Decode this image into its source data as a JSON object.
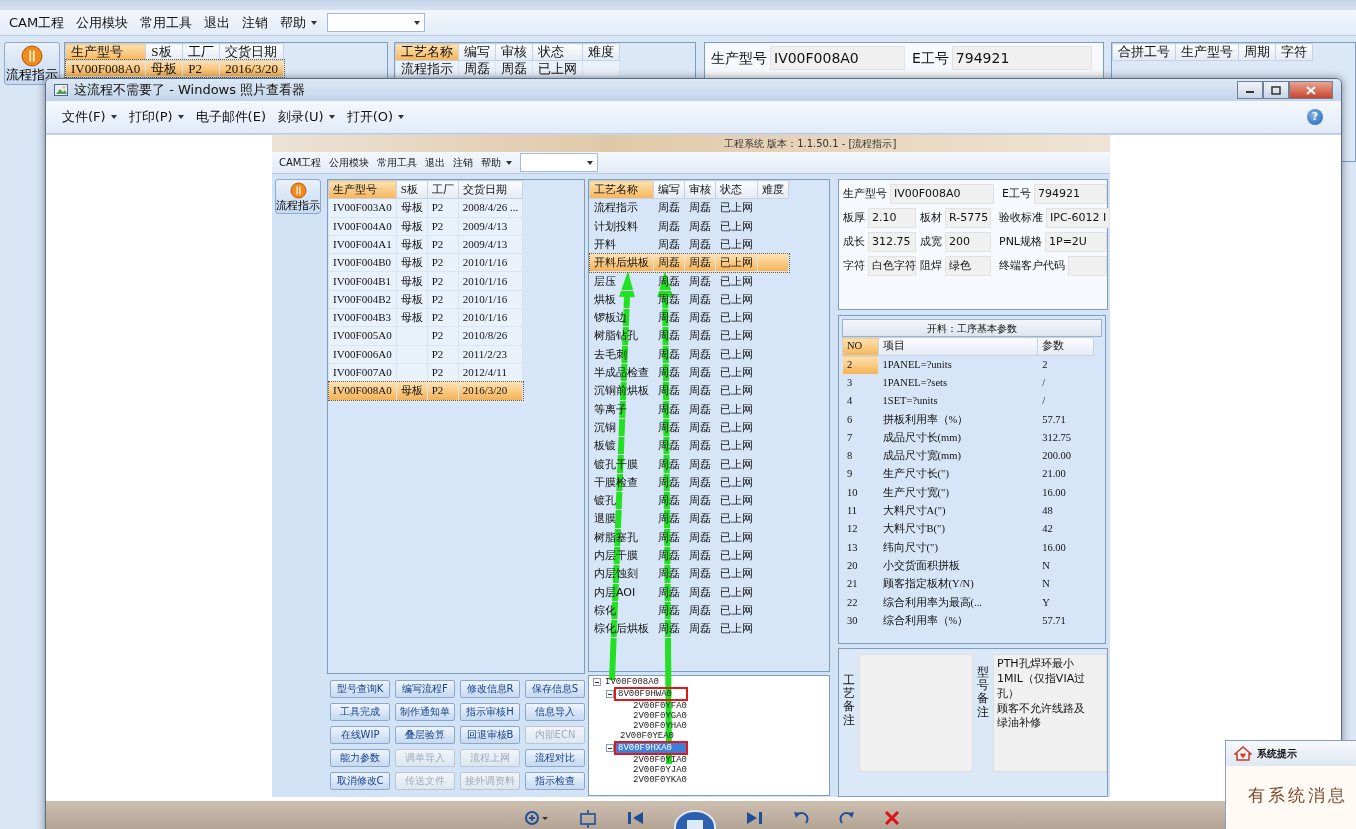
{
  "outer_app": {
    "menu": [
      {
        "label": "CAM工程",
        "caret": false
      },
      {
        "label": "公用模块",
        "caret": false
      },
      {
        "label": "常用工具",
        "caret": false
      },
      {
        "label": "退出",
        "caret": false
      },
      {
        "label": "注销",
        "caret": false
      },
      {
        "label": "帮助",
        "caret": true
      }
    ],
    "side_button": {
      "label": "流程指示"
    },
    "orders_table": {
      "columns": [
        {
          "label": "生产型号",
          "sorted": true
        },
        {
          "label": "S板",
          "sorted": false
        },
        {
          "label": "工厂",
          "sorted": false
        },
        {
          "label": "交货日期",
          "sorted": false
        }
      ],
      "rows": [
        {
          "model": "IV00F008A0",
          "board": "母板",
          "factory": "P2",
          "date": "2016/3/20",
          "selected": true
        }
      ]
    },
    "process_table": {
      "columns": [
        {
          "label": "工艺名称",
          "sorted": true
        },
        {
          "label": "编写",
          "sorted": false
        },
        {
          "label": "审核",
          "sorted": false
        },
        {
          "label": "状态",
          "sorted": false
        },
        {
          "label": "难度",
          "sorted": false
        }
      ],
      "rows": [
        {
          "name": "流程指示",
          "writer": "周磊",
          "reviewer": "周磊",
          "status": "已上网",
          "selected": false
        }
      ]
    },
    "info_fields": [
      {
        "label": "生产型号",
        "value": "IV00F008A0"
      },
      {
        "label": "E工号",
        "value": "794921"
      }
    ],
    "merge_table": {
      "columns": [
        {
          "label": "合拼工号",
          "sorted": false
        },
        {
          "label": "生产型号",
          "sorted": false
        },
        {
          "label": "周期",
          "sorted": false
        },
        {
          "label": "字符",
          "sorted": false
        }
      ]
    }
  },
  "viewer": {
    "title": "这流程不需要了 - Windows 照片查看器",
    "menu": [
      {
        "label": "文件(F)",
        "caret": true
      },
      {
        "label": "打印(P)",
        "caret": true
      },
      {
        "label": "电子邮件(E)",
        "caret": false
      },
      {
        "label": "刻录(U)",
        "caret": true
      },
      {
        "label": "打开(O)",
        "caret": true
      }
    ],
    "help": "?",
    "screenshot": {
      "title": "工程系统 版本：1.1.50.1 - [流程指示]",
      "menu": [
        {
          "label": "CAM工程",
          "caret": false
        },
        {
          "label": "公用模块",
          "caret": false
        },
        {
          "label": "常用工具",
          "caret": false
        },
        {
          "label": "退出",
          "caret": false
        },
        {
          "label": "注销",
          "caret": false
        },
        {
          "label": "帮助",
          "caret": true
        }
      ],
      "side_button": {
        "label": "流程指示"
      },
      "orders_table": {
        "columns": [
          {
            "label": "生产型号",
            "sorted": true
          },
          {
            "label": "S板",
            "sorted": false
          },
          {
            "label": "工厂",
            "sorted": false
          },
          {
            "label": "交货日期",
            "sorted": false
          }
        ],
        "rows": [
          {
            "model": "IV00F003A0",
            "board": "母板",
            "factory": "P2",
            "date": "2008/4/26 ...",
            "selected": false
          },
          {
            "model": "IV00F004A0",
            "board": "母板",
            "factory": "P2",
            "date": "2009/4/13",
            "selected": false
          },
          {
            "model": "IV00F004A1",
            "board": "母板",
            "factory": "P2",
            "date": "2009/4/13",
            "selected": false
          },
          {
            "model": "IV00F004B0",
            "board": "母板",
            "factory": "P2",
            "date": "2010/1/16",
            "selected": false
          },
          {
            "model": "IV00F004B1",
            "board": "母板",
            "factory": "P2",
            "date": "2010/1/16",
            "selected": false
          },
          {
            "model": "IV00F004B2",
            "board": "母板",
            "factory": "P2",
            "date": "2010/1/16",
            "selected": false
          },
          {
            "model": "IV00F004B3",
            "board": "母板",
            "factory": "P2",
            "date": "2010/1/16",
            "selected": false
          },
          {
            "model": "IV00F005A0",
            "factory": "P2",
            "date": "2010/8/26",
            "selected": false
          },
          {
            "model": "IV00F006A0",
            "factory": "P2",
            "date": "2011/2/23",
            "selected": false
          },
          {
            "model": "IV00F007A0",
            "factory": "P2",
            "date": "2012/4/11",
            "selected": false
          },
          {
            "model": "IV00F008A0",
            "board": "母板",
            "factory": "P2",
            "date": "2016/3/20",
            "selected": true
          }
        ]
      },
      "buttons": [
        {
          "label": "型号查询K",
          "disabled": false
        },
        {
          "label": "编写流程F",
          "disabled": false
        },
        {
          "label": "修改信息R",
          "disabled": false
        },
        {
          "label": "保存信息S",
          "disabled": false
        },
        {
          "label": "工具完成",
          "disabled": false
        },
        {
          "label": "制作通知单",
          "disabled": false
        },
        {
          "label": "指示审核H",
          "disabled": false
        },
        {
          "label": "信息导入",
          "disabled": false
        },
        {
          "label": "在线WIP",
          "disabled": false
        },
        {
          "label": "叠层验算",
          "disabled": false
        },
        {
          "label": "回退审核B",
          "disabled": false
        },
        {
          "label": "内部ECN",
          "disabled": true
        },
        {
          "label": "能力参数",
          "disabled": false
        },
        {
          "label": "调单导入",
          "disabled": true
        },
        {
          "label": "流程上网",
          "disabled": true
        },
        {
          "label": "流程对比",
          "disabled": false
        },
        {
          "label": "取消修改C",
          "disabled": false
        },
        {
          "label": "传送文件",
          "disabled": true
        },
        {
          "label": "接外调资料",
          "disabled": true
        },
        {
          "label": "指示检查",
          "disabled": false
        }
      ],
      "process_table": {
        "columns": [
          {
            "label": "工艺名称",
            "sorted": true
          },
          {
            "label": "编写",
            "sorted": false
          },
          {
            "label": "审核",
            "sorted": false
          },
          {
            "label": "状态",
            "sorted": false
          },
          {
            "label": "难度",
            "sorted": false
          }
        ],
        "rows": [
          {
            "name": "流程指示",
            "writer": "周磊",
            "reviewer": "周磊",
            "status": "已上网",
            "selected": false
          },
          {
            "name": "计划投料",
            "writer": "周磊",
            "reviewer": "周磊",
            "status": "已上网",
            "selected": false
          },
          {
            "name": "开料",
            "writer": "周磊",
            "reviewer": "周磊",
            "status": "已上网",
            "selected": false
          },
          {
            "name": "开料后烘板",
            "writer": "周磊",
            "reviewer": "周磊",
            "status": "已上网",
            "selected": true
          },
          {
            "name": "层压",
            "writer": "周磊",
            "reviewer": "周磊",
            "status": "已上网",
            "selected": false
          },
          {
            "name": "烘板",
            "writer": "周磊",
            "reviewer": "周磊",
            "status": "已上网",
            "selected": false
          },
          {
            "name": "锣板边",
            "writer": "周磊",
            "reviewer": "周磊",
            "status": "已上网",
            "selected": false
          },
          {
            "name": "树脂钻孔",
            "writer": "周磊",
            "reviewer": "周磊",
            "status": "已上网",
            "selected": false
          },
          {
            "name": "去毛刺",
            "writer": "周磊",
            "reviewer": "周磊",
            "status": "已上网",
            "selected": false
          },
          {
            "name": "半成品检查",
            "writer": "周磊",
            "reviewer": "周磊",
            "status": "已上网",
            "selected": false
          },
          {
            "name": "沉铜前烘板",
            "writer": "周磊",
            "reviewer": "周磊",
            "status": "已上网",
            "selected": false
          },
          {
            "name": "等离子",
            "writer": "周磊",
            "reviewer": "周磊",
            "status": "已上网",
            "selected": false
          },
          {
            "name": "沉铜",
            "writer": "周磊",
            "reviewer": "周磊",
            "status": "已上网",
            "selected": false
          },
          {
            "name": "板镀",
            "writer": "周磊",
            "reviewer": "周磊",
            "status": "已上网",
            "selected": false
          },
          {
            "name": "镀孔干膜",
            "writer": "周磊",
            "reviewer": "周磊",
            "status": "已上网",
            "selected": false
          },
          {
            "name": "干膜检查",
            "writer": "周磊",
            "reviewer": "周磊",
            "status": "已上网",
            "selected": false
          },
          {
            "name": "镀孔",
            "writer": "周磊",
            "reviewer": "周磊",
            "status": "已上网",
            "selected": false
          },
          {
            "name": "退膜",
            "writer": "周磊",
            "reviewer": "周磊",
            "status": "已上网",
            "selected": false
          },
          {
            "name": "树脂塞孔",
            "writer": "周磊",
            "reviewer": "周磊",
            "status": "已上网",
            "selected": false
          },
          {
            "name": "内层干膜",
            "writer": "周磊",
            "reviewer": "周磊",
            "status": "已上网",
            "selected": false
          },
          {
            "name": "内层蚀刻",
            "writer": "周磊",
            "reviewer": "周磊",
            "status": "已上网",
            "selected": false
          },
          {
            "name": "内层AOI",
            "writer": "周磊",
            "reviewer": "周磊",
            "status": "已上网",
            "selected": false
          },
          {
            "name": "棕化",
            "writer": "周磊",
            "reviewer": "周磊",
            "status": "已上网",
            "selected": false
          },
          {
            "name": "棕化后烘板",
            "writer": "周磊",
            "reviewer": "周磊",
            "status": "已上网",
            "selected": false
          }
        ]
      },
      "tree": [
        {
          "label": "IV00F008A0",
          "expanded": true,
          "selected": false,
          "annotated": false,
          "children": [
            {
              "label": "8V00F9HWA0",
              "expanded": true,
              "selected": false,
              "annotated": true,
              "children": [
                {
                  "label": "2V00F0YFA0",
                  "selected": false,
                  "annotated": false
                },
                {
                  "label": "2V00F0YGA0",
                  "selected": false,
                  "annotated": false
                },
                {
                  "label": "2V00F0YHA0",
                  "selected": false,
                  "annotated": false
                }
              ]
            },
            {
              "label": "2V00F0YEA0",
              "selected": false,
              "annotated": false
            },
            {
              "label": "8V00F9HXA0",
              "expanded": true,
              "selected": true,
              "annotated": true,
              "children": [
                {
                  "label": "2V00F0YIA0",
                  "selected": false,
                  "annotated": false
                },
                {
                  "label": "2V00F0YJA0",
                  "selected": false,
                  "annotated": false
                },
                {
                  "label": "2V00F0YKA0",
                  "selected": false,
                  "annotated": false
                }
              ]
            }
          ]
        }
      ],
      "info_rows": [
        [
          {
            "label": "生产型号",
            "value": "IV00F008A0"
          },
          {
            "label": "E工号",
            "value": "794921"
          }
        ],
        [
          {
            "label": "板厚",
            "value": "2.10"
          },
          {
            "label": "板材",
            "value": "R-5775"
          },
          {
            "label": "验收标准",
            "value": "IPC-6012 I"
          }
        ],
        [
          {
            "label": "成长",
            "value": "312.75"
          },
          {
            "label": "成宽",
            "value": "200"
          },
          {
            "label": "PNL规格",
            "value": "1P=2U"
          }
        ],
        [
          {
            "label": "字符",
            "value": "白色字符"
          },
          {
            "label": "阻焊",
            "value": "绿色"
          },
          {
            "label": "终端客户代码"
          }
        ]
      ],
      "params_table": {
        "title": "开料：工序基本参数",
        "columns": [
          {
            "label": "NO",
            "sorted": true
          },
          {
            "label": "项目",
            "sorted": false
          },
          {
            "label": "参数",
            "sorted": false
          }
        ],
        "rows": [
          {
            "no": "2",
            "item": "1PANEL=?units",
            "value": "2",
            "selected": true
          },
          {
            "no": "3",
            "item": "1PANEL=?sets",
            "value": "/",
            "selected": false
          },
          {
            "no": "4",
            "item": "1SET=?units",
            "value": "/",
            "selected": false
          },
          {
            "no": "6",
            "item": "拼板利用率（%）",
            "value": "57.71",
            "selected": false
          },
          {
            "no": "7",
            "item": "成品尺寸长(mm)",
            "value": "312.75",
            "selected": false
          },
          {
            "no": "8",
            "item": "成品尺寸宽(mm)",
            "value": "200.00",
            "selected": false
          },
          {
            "no": "9",
            "item": "生产尺寸长(\")",
            "value": "21.00",
            "selected": false
          },
          {
            "no": "10",
            "item": "生产尺寸宽(\")",
            "value": "16.00",
            "selected": false
          },
          {
            "no": "11",
            "item": "大料尺寸A(\")",
            "value": "48",
            "selected": false
          },
          {
            "no": "12",
            "item": "大料尺寸B(\")",
            "value": "42",
            "selected": false
          },
          {
            "no": "13",
            "item": "纬向尺寸(\")",
            "value": "16.00",
            "selected": false
          },
          {
            "no": "20",
            "item": "小交货面积拼板",
            "value": "N",
            "selected": false
          },
          {
            "no": "21",
            "item": "顾客指定板材(Y/N)",
            "value": "N",
            "selected": false
          },
          {
            "no": "22",
            "item": "综合利用率为最高(...",
            "value": "Y",
            "selected": false
          },
          {
            "no": "30",
            "item": "综合利用率（%）",
            "value": "57.71",
            "selected": false
          }
        ]
      },
      "notes": [
        {
          "label": "工艺备注"
        },
        {
          "label": "型号备注",
          "text": [
            "PTH孔焊环最小1MIL（仅指VIA过孔）",
            "顾客不允许线路及绿油补修"
          ]
        }
      ]
    }
  },
  "popup": {
    "title": "系统提示",
    "message": "有系统消息"
  }
}
